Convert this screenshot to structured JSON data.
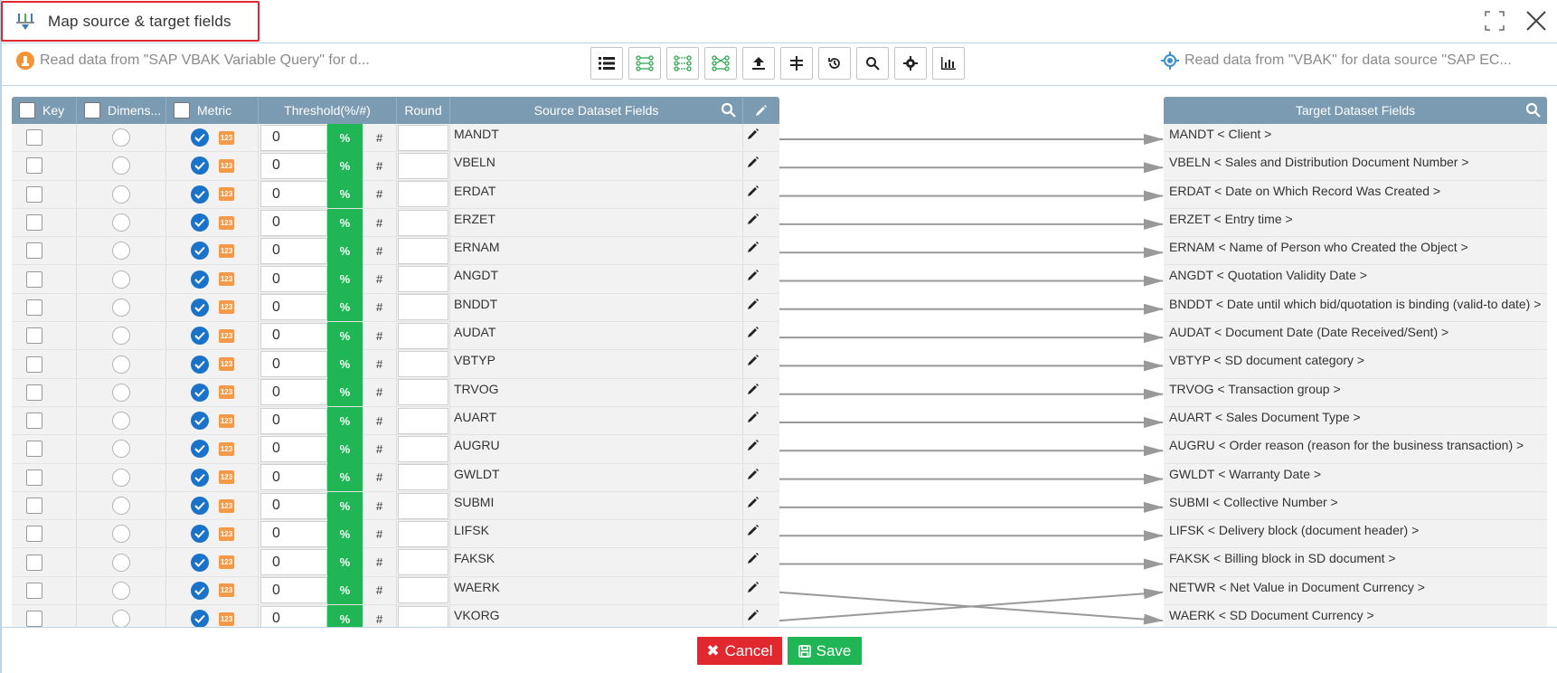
{
  "window": {
    "title": "Map source & target fields"
  },
  "info": {
    "source_text": "Read data from \"SAP VBAK Variable Query\" for d...",
    "target_text": "Read data from \"VBAK\" for data source \"SAP EC..."
  },
  "toolbar": {
    "buttons": [
      "list-icon",
      "map-all-icon",
      "map-by-name-icon",
      "map-by-position-icon",
      "upload-icon",
      "split-icon",
      "history-icon",
      "search-icon",
      "gear-icon",
      "bar-chart-icon"
    ]
  },
  "left_grid": {
    "headers": {
      "key": "Key",
      "dimension": "Dimens...",
      "metric": "Metric",
      "threshold": "Threshold(%/#)",
      "round": "Round",
      "source": "Source Dataset Fields"
    },
    "percent_label": "%",
    "hash_label": "#",
    "badge_label": "123",
    "rows": [
      {
        "field": "MANDT",
        "threshold": "0"
      },
      {
        "field": "VBELN",
        "threshold": "0"
      },
      {
        "field": "ERDAT",
        "threshold": "0"
      },
      {
        "field": "ERZET",
        "threshold": "0"
      },
      {
        "field": "ERNAM",
        "threshold": "0"
      },
      {
        "field": "ANGDT",
        "threshold": "0"
      },
      {
        "field": "BNDDT",
        "threshold": "0"
      },
      {
        "field": "AUDAT",
        "threshold": "0"
      },
      {
        "field": "VBTYP",
        "threshold": "0"
      },
      {
        "field": "TRVOG",
        "threshold": "0"
      },
      {
        "field": "AUART",
        "threshold": "0"
      },
      {
        "field": "AUGRU",
        "threshold": "0"
      },
      {
        "field": "GWLDT",
        "threshold": "0"
      },
      {
        "field": "SUBMI",
        "threshold": "0"
      },
      {
        "field": "LIFSK",
        "threshold": "0"
      },
      {
        "field": "FAKSK",
        "threshold": "0"
      },
      {
        "field": "WAERK",
        "threshold": "0"
      },
      {
        "field": "VKORG",
        "threshold": "0"
      }
    ]
  },
  "right_grid": {
    "header": "Target Dataset Fields",
    "rows": [
      "MANDT < Client >",
      "VBELN < Sales and Distribution Document Number >",
      "ERDAT < Date on Which Record Was Created >",
      "ERZET < Entry time >",
      "ERNAM < Name of Person who Created the Object >",
      "ANGDT < Quotation Validity Date >",
      "BNDDT < Date until which bid/quotation is binding (valid-to date) >",
      "AUDAT < Document Date (Date Received/Sent) >",
      "VBTYP < SD document category >",
      "TRVOG < Transaction group >",
      "AUART < Sales Document Type >",
      "AUGRU < Order reason (reason for the business transaction) >",
      "GWLDT < Warranty Date >",
      "SUBMI < Collective Number >",
      "LIFSK < Delivery block (document header) >",
      "FAKSK < Billing block in SD document >",
      "NETWR < Net Value in Document Currency >",
      "WAERK < SD Document Currency >"
    ]
  },
  "mappings": [
    [
      0,
      0
    ],
    [
      1,
      1
    ],
    [
      2,
      2
    ],
    [
      3,
      3
    ],
    [
      4,
      4
    ],
    [
      5,
      5
    ],
    [
      6,
      6
    ],
    [
      7,
      7
    ],
    [
      8,
      8
    ],
    [
      9,
      9
    ],
    [
      10,
      10
    ],
    [
      11,
      11
    ],
    [
      12,
      12
    ],
    [
      13,
      13
    ],
    [
      14,
      14
    ],
    [
      15,
      15
    ],
    [
      16,
      17
    ],
    [
      17,
      16
    ]
  ],
  "footer": {
    "cancel_label": "Cancel",
    "save_label": "Save"
  },
  "colors": {
    "header_bg": "#7a9bb1",
    "accent_green": "#21b655",
    "accent_red": "#e0282e",
    "metric_blue": "#1a73c8",
    "badge_orange": "#f29a4a",
    "line_gray": "#999999"
  }
}
